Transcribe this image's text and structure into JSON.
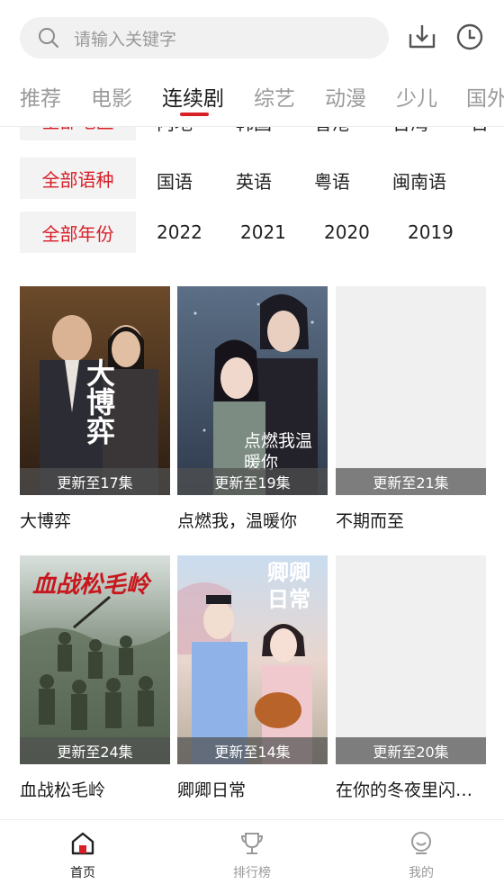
{
  "search": {
    "placeholder": "请输入关键字"
  },
  "header_icons": [
    "download-icon",
    "history-clock-icon"
  ],
  "tabs": [
    {
      "label": "推荐",
      "active": false
    },
    {
      "label": "电影",
      "active": false
    },
    {
      "label": "连续剧",
      "active": true
    },
    {
      "label": "综艺",
      "active": false
    },
    {
      "label": "动漫",
      "active": false
    },
    {
      "label": "少儿",
      "active": false
    },
    {
      "label": "国外",
      "active": false
    }
  ],
  "filters": {
    "region": {
      "chip": "全部地区",
      "options": [
        "内地",
        "韩国",
        "香港",
        "台湾",
        "日"
      ]
    },
    "language": {
      "chip": "全部语种",
      "options": [
        "国语",
        "英语",
        "粤语",
        "闽南语"
      ]
    },
    "year": {
      "chip": "全部年份",
      "options": [
        "2022",
        "2021",
        "2020",
        "2019"
      ]
    }
  },
  "cards": [
    {
      "title": "大博弈",
      "episode": "更新至17集",
      "poster_text": "大博弈"
    },
    {
      "title": "点燃我，温暖你",
      "episode": "更新至19集",
      "poster_text": "点燃我温暖你"
    },
    {
      "title": "不期而至",
      "episode": "更新至21集"
    },
    {
      "title": "血战松毛岭",
      "episode": "更新至24集",
      "poster_text": "血战松毛岭"
    },
    {
      "title": "卿卿日常",
      "episode": "更新至14集",
      "poster_text": "卿卿日常"
    },
    {
      "title": "在你的冬夜里闪…",
      "episode": "更新至20集"
    }
  ],
  "bottom_nav": [
    {
      "label": "首页",
      "icon": "home-icon",
      "active": true
    },
    {
      "label": "排行榜",
      "icon": "trophy-icon",
      "active": false
    },
    {
      "label": "我的",
      "icon": "profile-icon",
      "active": false
    }
  ],
  "colors": {
    "accent": "#d81e27",
    "chip_bg": "#f3f3f3",
    "muted": "#9a9a9a"
  }
}
